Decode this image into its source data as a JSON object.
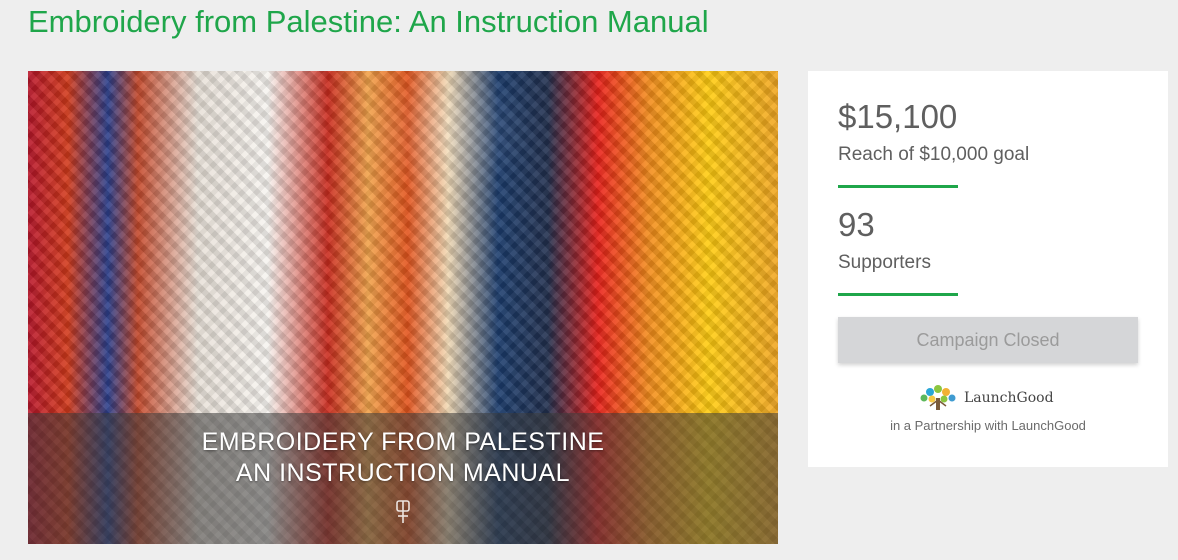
{
  "campaign": {
    "title": "Embroidery from Palestine: An Instruction Manual",
    "hero": {
      "caption_line1": "EMBROIDERY FROM PALESTINE",
      "caption_line2": "AN INSTRUCTION MANUAL"
    }
  },
  "stats": {
    "amount": "$15,100",
    "goal_text": "Reach of $10,000 goal",
    "supporters_count": "93",
    "supporters_label": "Supporters"
  },
  "cta": {
    "label": "Campaign Closed"
  },
  "partner": {
    "logo_name": "LaunchGood",
    "logo_icon": "tree-icon",
    "text": "in a Partnership with LaunchGood"
  },
  "colors": {
    "accent": "#1fa64a",
    "button_bg": "#d5d6d8",
    "button_text": "#9b9b9b",
    "stat_text": "#5f5f5f"
  }
}
